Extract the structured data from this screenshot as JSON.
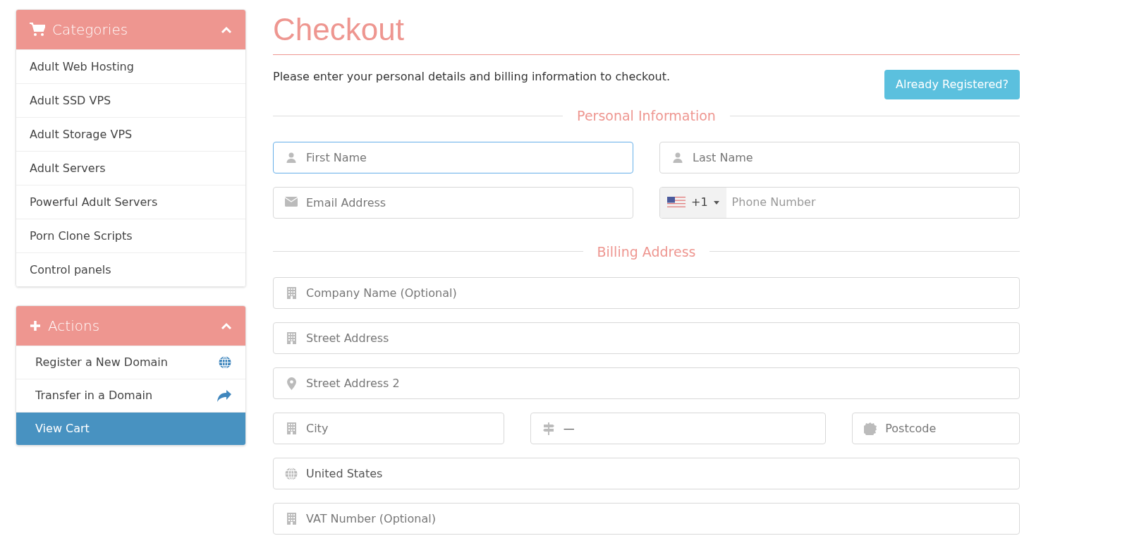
{
  "sidebar": {
    "panels": [
      {
        "title": "Categories",
        "expanded": true,
        "items": [
          {
            "label": "Adult Web Hosting",
            "selected": false
          },
          {
            "label": "Adult SSD VPS",
            "selected": false
          },
          {
            "label": "Adult Storage VPS",
            "selected": false
          },
          {
            "label": "Adult Servers",
            "selected": false
          },
          {
            "label": "Powerful Adult Servers",
            "selected": false
          },
          {
            "label": "Porn Clone Scripts",
            "selected": false
          },
          {
            "label": "Control panels",
            "selected": false
          }
        ]
      },
      {
        "title": "Actions",
        "expanded": true,
        "items": [
          {
            "label": "Register a New Domain",
            "selected": false
          },
          {
            "label": "Transfer in a Domain",
            "selected": false
          },
          {
            "label": "View Cart",
            "selected": true
          }
        ]
      }
    ]
  },
  "checkout": {
    "title": "Checkout",
    "intro": "Please enter your personal details and billing information to checkout.",
    "button": "Already Registered?",
    "sections": [
      {
        "heading": "Personal Information",
        "rows": [
          [
            {
              "kind": "text",
              "placeholder": "First Name",
              "focused": true
            },
            {
              "kind": "text",
              "placeholder": "Last Name",
              "focused": false
            }
          ],
          [
            {
              "kind": "text",
              "placeholder": "Email Address",
              "focused": false
            },
            {
              "kind": "phone",
              "code": "+1",
              "placeholder": "Phone Number",
              "focused": false
            }
          ]
        ]
      },
      {
        "heading": "Billing Address",
        "rows": [
          [
            {
              "kind": "text",
              "placeholder": "Company Name (Optional)",
              "focused": false
            }
          ],
          [
            {
              "kind": "text",
              "placeholder": "Street Address",
              "focused": false
            }
          ],
          [
            {
              "kind": "text",
              "placeholder": "Street Address 2",
              "focused": false
            }
          ],
          [
            {
              "kind": "text",
              "placeholder": "City",
              "focused": false
            },
            {
              "kind": "select",
              "value": "—",
              "focused": false
            },
            {
              "kind": "text",
              "placeholder": "Postcode",
              "focused": false
            }
          ],
          [
            {
              "kind": "select",
              "value": "United States",
              "focused": false
            }
          ],
          [
            {
              "kind": "text",
              "placeholder": "VAT Number (Optional)",
              "focused": false
            }
          ]
        ]
      }
    ]
  }
}
